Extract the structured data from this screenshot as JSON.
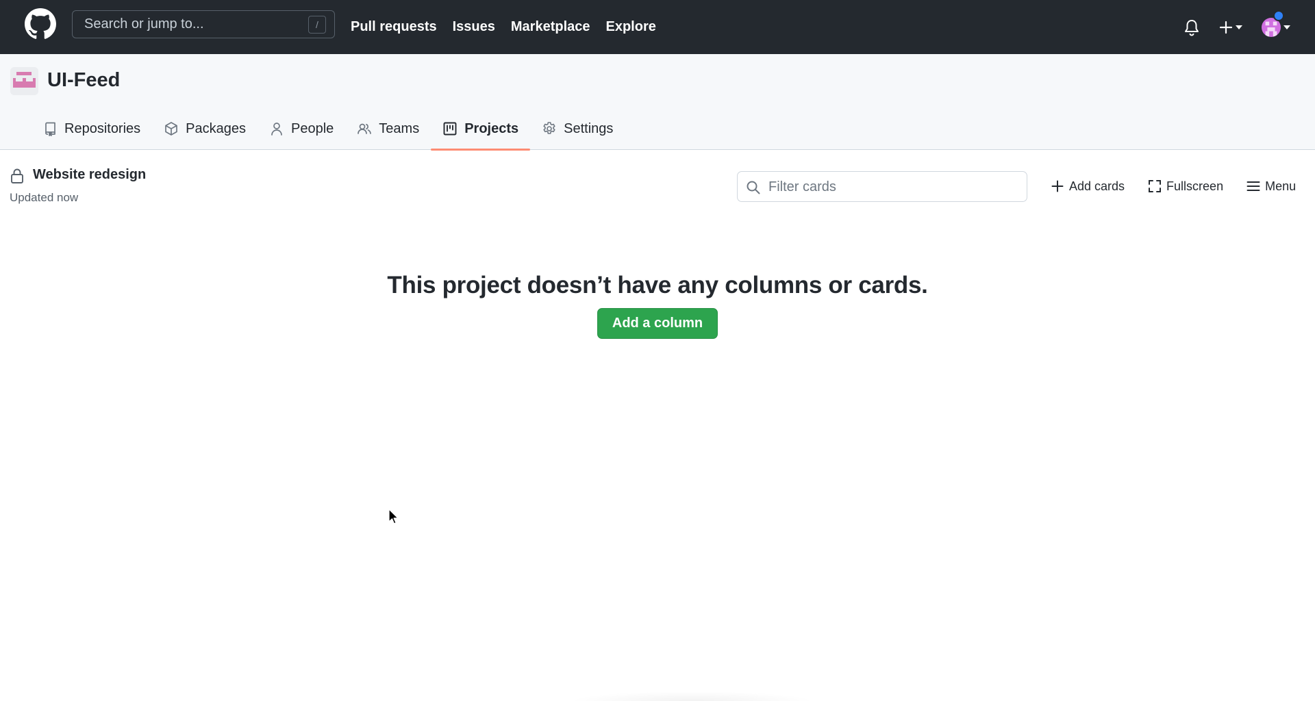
{
  "header": {
    "search_placeholder": "Search or jump to...",
    "search_shortcut": "/",
    "nav": [
      "Pull requests",
      "Issues",
      "Marketplace",
      "Explore"
    ],
    "icons": [
      "github-logo-icon",
      "bell-icon",
      "plus-icon",
      "avatar"
    ]
  },
  "org": {
    "name": "UI-Feed",
    "tabs": [
      {
        "label": "Repositories",
        "icon": "repo-icon"
      },
      {
        "label": "Packages",
        "icon": "package-icon"
      },
      {
        "label": "People",
        "icon": "person-icon"
      },
      {
        "label": "Teams",
        "icon": "people-icon"
      },
      {
        "label": "Projects",
        "icon": "project-icon",
        "active": true
      },
      {
        "label": "Settings",
        "icon": "gear-icon"
      }
    ]
  },
  "project": {
    "title": "Website redesign",
    "updated": "Updated now",
    "filter_placeholder": "Filter cards",
    "actions": {
      "add_cards": "Add cards",
      "fullscreen": "Fullscreen",
      "menu": "Menu"
    }
  },
  "empty_state": {
    "title": "This project doesn’t have any columns or cards.",
    "button": "Add a column"
  },
  "colors": {
    "header_bg": "#24292f",
    "active_tab_underline": "#fd8c73",
    "primary_button": "#2da44e",
    "notification_dot": "#2f81f7",
    "org_avatar_pink": "#d87bb0"
  }
}
